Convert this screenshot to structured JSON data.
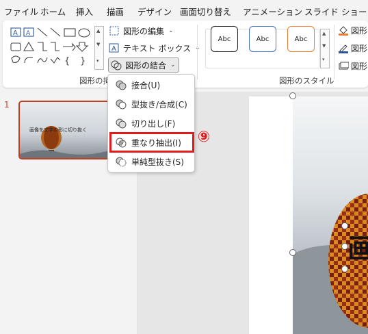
{
  "menu": {
    "tabs": [
      "ファイル",
      "ホーム",
      "挿入",
      "描画",
      "デザイン",
      "画面切り替え",
      "アニメーション",
      "スライド ショー"
    ]
  },
  "ribbon": {
    "insert_shapes_group": "図形の挿入",
    "edit_shape_label": "図形の編集",
    "textbox_label": "テキスト ボックス",
    "merge_shapes_label": "図形の結合",
    "shape_styles_group": "図形のスタイル",
    "style_samples": [
      "Abc",
      "Abc",
      "Abc"
    ],
    "format_items": [
      "図形",
      "図形",
      "図形"
    ]
  },
  "merge_menu": {
    "items": [
      "接合(U)",
      "型抜き/合成(C)",
      "切り出し(F)",
      "重なり抽出(I)",
      "単純型抜き(S)"
    ],
    "highlighted_index": 3
  },
  "step_marker": "⑨",
  "slides": {
    "current_number": "1",
    "thumbnail_text": "画像を文字の形に切り抜く"
  },
  "slide_canvas": {
    "visible_text": "画"
  },
  "colors": {
    "accent": "#c43e1c",
    "highlight": "#e11b1b",
    "icon_blue": "#2b579a"
  }
}
